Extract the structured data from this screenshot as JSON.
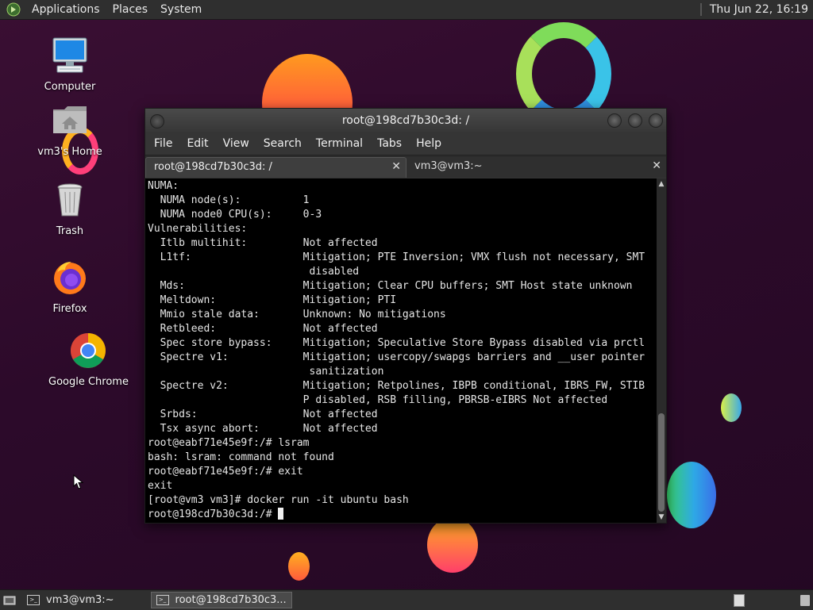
{
  "top_panel": {
    "menus": [
      "Applications",
      "Places",
      "System"
    ],
    "clock": "Thu Jun 22, 16:19"
  },
  "desktop_icons": [
    {
      "label": "Computer",
      "icon": "computer-icon"
    },
    {
      "label": "vm3's Home",
      "icon": "home-folder-icon"
    },
    {
      "label": "Trash",
      "icon": "trash-icon"
    },
    {
      "label": "Firefox",
      "icon": "firefox-icon"
    },
    {
      "label": "Google Chrome",
      "icon": "chrome-icon"
    }
  ],
  "window": {
    "title": "root@198cd7b30c3d: /",
    "menu": [
      "File",
      "Edit",
      "View",
      "Search",
      "Terminal",
      "Tabs",
      "Help"
    ],
    "tabs": [
      {
        "label": "root@198cd7b30c3d: /",
        "active": true
      },
      {
        "label": "vm3@vm3:~",
        "active": false
      }
    ],
    "terminal_lines": [
      "NUMA:",
      "  NUMA node(s):          1",
      "  NUMA node0 CPU(s):     0-3",
      "Vulnerabilities:",
      "  Itlb multihit:         Not affected",
      "  L1tf:                  Mitigation; PTE Inversion; VMX flush not necessary, SMT",
      "                          disabled",
      "  Mds:                   Mitigation; Clear CPU buffers; SMT Host state unknown",
      "  Meltdown:              Mitigation; PTI",
      "  Mmio stale data:       Unknown: No mitigations",
      "  Retbleed:              Not affected",
      "  Spec store bypass:     Mitigation; Speculative Store Bypass disabled via prctl",
      "  Spectre v1:            Mitigation; usercopy/swapgs barriers and __user pointer",
      "                          sanitization",
      "  Spectre v2:            Mitigation; Retpolines, IBPB conditional, IBRS_FW, STIB",
      "                         P disabled, RSB filling, PBRSB-eIBRS Not affected",
      "  Srbds:                 Not affected",
      "  Tsx async abort:       Not affected",
      "root@eabf71e45e9f:/# lsram",
      "bash: lsram: command not found",
      "root@eabf71e45e9f:/# exit",
      "exit",
      "[root@vm3 vm3]# docker run -it ubuntu bash"
    ],
    "prompt": "root@198cd7b30c3d:/# "
  },
  "taskbar": {
    "tasks": [
      {
        "label": "vm3@vm3:~",
        "active": false
      },
      {
        "label": "root@198cd7b30c3...",
        "active": true
      }
    ]
  },
  "colors": {
    "desktop_bg": "#2c0a2a",
    "panel_bg": "#2f2f2f",
    "terminal_bg": "#000000",
    "terminal_fg": "#e6e6e6"
  }
}
